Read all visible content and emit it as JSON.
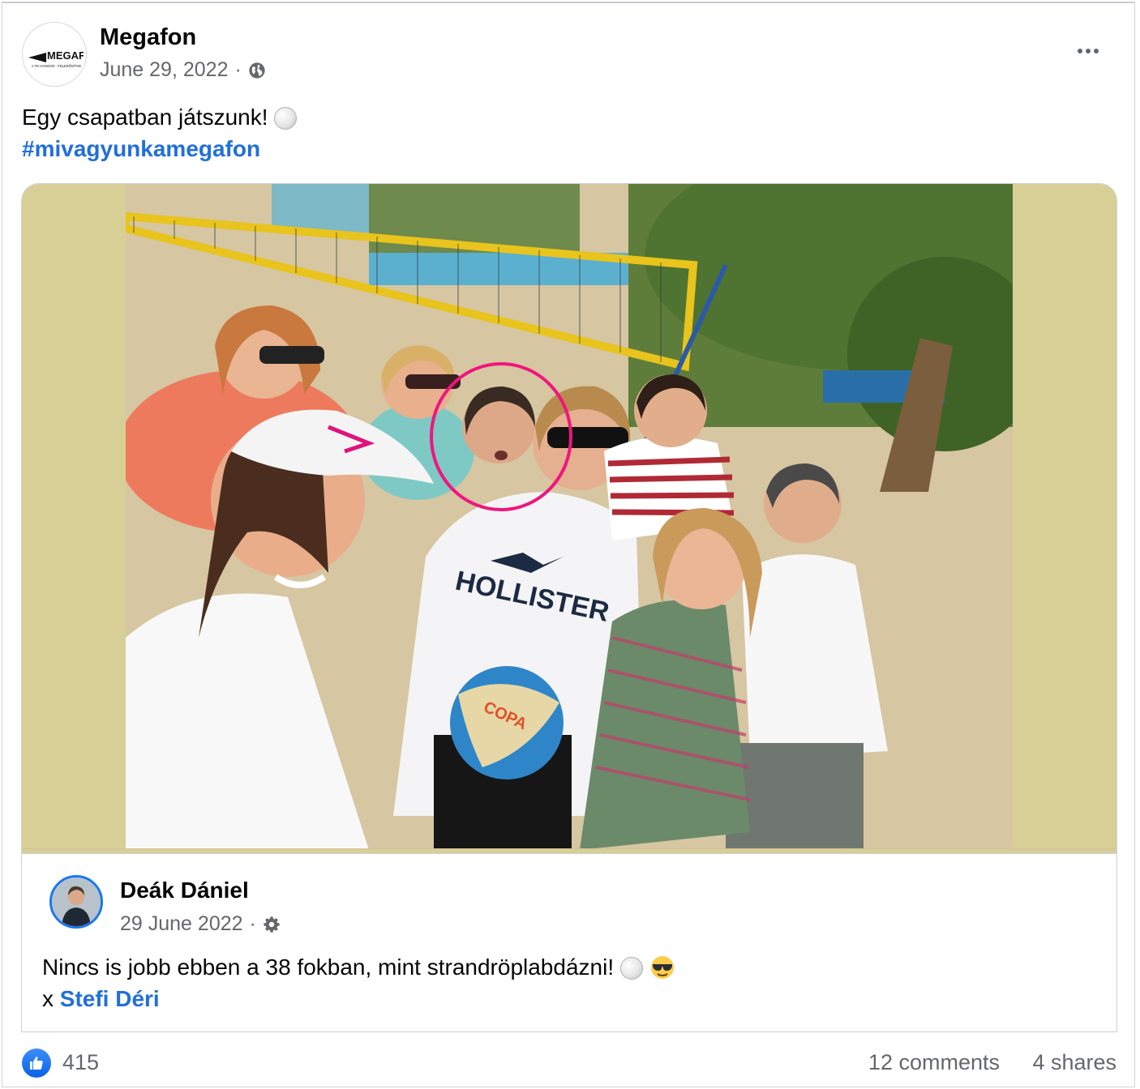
{
  "post": {
    "author": "Megafon",
    "date": "June 29, 2022",
    "separator": "·",
    "logo_text": "MEGAFON",
    "logo_subtext": "A TE HANGOD · FELERŐSÍTVE",
    "text": "Egy csapatban játszunk!",
    "hashtag": "#mivagyunkamegafon"
  },
  "shared_post": {
    "author": "Deák Dániel",
    "date": "29 June 2022",
    "separator": "·",
    "text": "Nincs is jobb ebben a 38 fokban, mint strandröplabdázni!",
    "tag_prefix": "x",
    "tagged_user": "Stefi Déri"
  },
  "photo": {
    "ball_text": "COPA"
  },
  "engagement": {
    "likes": "415",
    "comments": "12 comments",
    "shares": "4 shares"
  },
  "icons": {
    "privacy": "globe-icon",
    "shared_privacy": "gear-icon",
    "emoji_1": "volleyball-icon",
    "emoji_2": "sunglasses-face-icon",
    "reaction": "like-icon"
  },
  "colors": {
    "link": "#216fdb",
    "like": "#1877f2",
    "highlight_circle": "#f0157e"
  }
}
